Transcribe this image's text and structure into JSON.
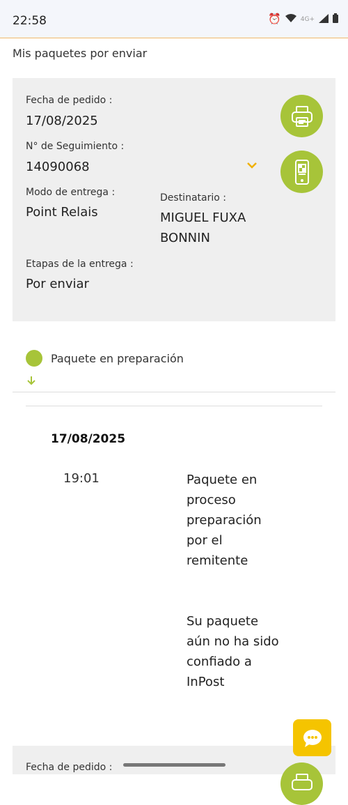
{
  "status_bar": {
    "time": "22:58",
    "network_label": "4G+",
    "icons": [
      "alarm-icon",
      "wifi-icon",
      "signal-icon",
      "battery-icon"
    ]
  },
  "page": {
    "title": "Mis paquetes por enviar"
  },
  "shipment": {
    "order_date_label": "Fecha de pedido :",
    "order_date": "17/08/2025",
    "tracking_label": "N° de Seguimiento :",
    "tracking_number": "14090068",
    "delivery_mode_label": "Modo de entrega :",
    "delivery_mode": "Point Relais",
    "recipient_label": "Destinatario :",
    "recipient_line1": "MIGUEL FUXA",
    "recipient_line2": "BONNIN",
    "stage_label": "Etapas de la entrega :",
    "stage": "Por enviar"
  },
  "timeline": {
    "step_label": "Paquete en preparación"
  },
  "details": {
    "date": "17/08/2025",
    "time": "19:01",
    "message_1": [
      "Paquete en",
      "proceso",
      "preparación",
      "por el",
      "remitente"
    ],
    "message_2": [
      "Su paquete",
      "aún no ha sido",
      "confiado a",
      "InPost"
    ]
  },
  "next_card": {
    "order_date_label": "Fecha de pedido :"
  },
  "colors": {
    "accent_green": "#a7c439",
    "accent_yellow": "#f5c400",
    "card_bg": "#efefef"
  }
}
